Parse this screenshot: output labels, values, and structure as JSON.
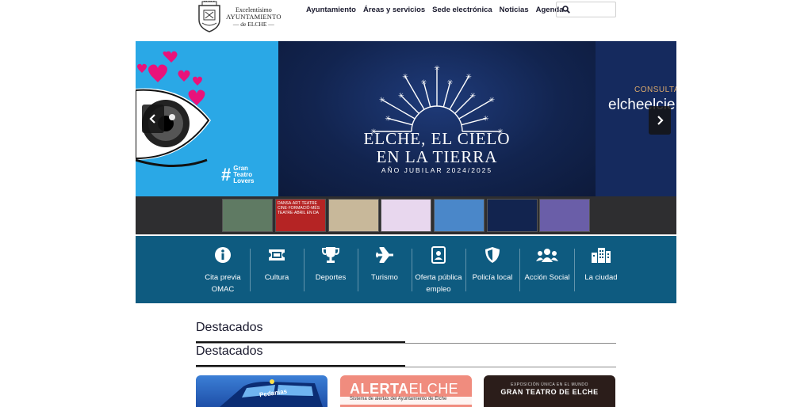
{
  "header": {
    "logo": {
      "line1": "Excelentísimo",
      "line2": "AYUNTAMIENTO",
      "line3": "— de ELCHE —"
    },
    "nav": [
      "Ayuntamiento",
      "Áreas y servicios",
      "Sede electrónica",
      "Noticias",
      "Agenda"
    ],
    "search": {
      "value": "",
      "icon": "search-icon"
    }
  },
  "hero": {
    "left_badge": "Gran Teatro Lovers",
    "title_line1": "ELCHE, EL CIELO",
    "title_line2": "EN LA TIERRA",
    "subtitle": "AÑO JUBILAR 2024/2025",
    "right_consulta": "CONSULTA",
    "right_brand": "elcheelcie",
    "prev_icon": "chevron-left-icon",
    "next_icon": "chevron-right-icon"
  },
  "thumbnails": [
    {
      "caption": "",
      "color": "#5f7a63"
    },
    {
      "caption": "DANSA·ART·TEATRE CINE·FORMACIÓ·MÉS TEATRE·ABRIL EN DA",
      "color": "#b52424"
    },
    {
      "caption": "",
      "color": "#c8b89a"
    },
    {
      "caption": "",
      "color": "#e8d7ee"
    },
    {
      "caption": "",
      "color": "#4a87c9"
    },
    {
      "caption": "",
      "color": "#12244f"
    },
    {
      "caption": "",
      "color": "#6a5ea8"
    }
  ],
  "services": [
    {
      "label": "Cita previa OMAC",
      "icon": "info-icon"
    },
    {
      "label": "Cultura",
      "icon": "ticket-icon"
    },
    {
      "label": "Deportes",
      "icon": "trophy-icon"
    },
    {
      "label": "Turismo",
      "icon": "plane-icon"
    },
    {
      "label": "Oferta pública empleo",
      "icon": "id-card-icon"
    },
    {
      "label": "Policía local",
      "icon": "shield-icon"
    },
    {
      "label": "Acción Social",
      "icon": "users-icon"
    },
    {
      "label": "La ciudad",
      "icon": "city-icon"
    }
  ],
  "sections": [
    "Destacados",
    "Destacados"
  ],
  "cards": [
    {
      "caption": "Pedanias"
    },
    {
      "title_bold": "ALERTA",
      "title_rest": "ELCHE",
      "caption": "Sistema de alertas del Ayuntamiento de Elche"
    },
    {
      "caption_small": "EXPOSICIÓN ÚNICA EN EL MUNDO",
      "caption_big": "GRAN TEATRO DE ELCHE"
    }
  ],
  "colors": {
    "services_bg": "#0e5b80",
    "hero_bg": "#0f1e45",
    "hero_left": "#2aa8e6"
  }
}
